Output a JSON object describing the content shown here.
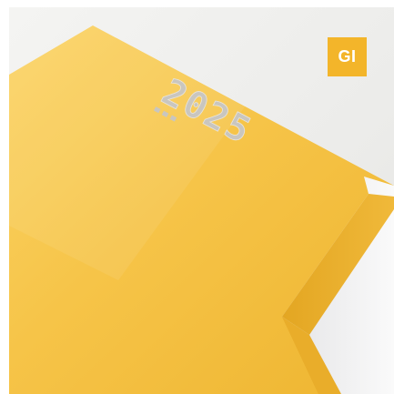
{
  "badge": {
    "label": "GI",
    "color": "#f3b52a"
  },
  "notebook": {
    "cover_text": "2025",
    "cover_color": "#f7c84a",
    "page_color": "#f1f1ef"
  }
}
